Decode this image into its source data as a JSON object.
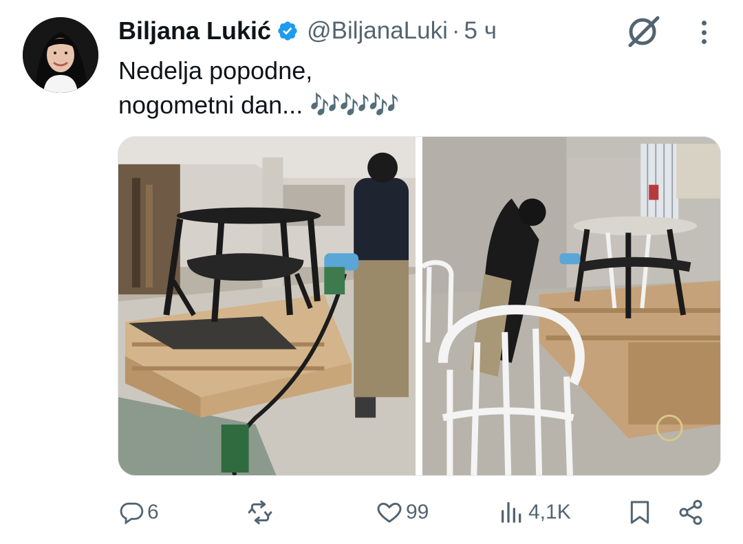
{
  "author": {
    "name": "Biljana Lukić",
    "handle": "@BiljanaLuki",
    "separator": "·",
    "time": "5 ч",
    "verified": true
  },
  "tweet": {
    "line1": "Nedelja popodne,",
    "line2": "nogometni dan...",
    "emoji": "🎶🎶🎶"
  },
  "media": {
    "count": 2
  },
  "actions": {
    "replies": "6",
    "retweets": "",
    "likes": "99",
    "views": "4,1K"
  },
  "colors": {
    "text": "#0f1419",
    "secondary": "#536471",
    "verified": "#1d9bf0"
  },
  "icons": [
    "verified-badge-icon",
    "grok-icon",
    "more-icon",
    "reply-icon",
    "retweet-icon",
    "like-icon",
    "views-icon",
    "bookmark-icon",
    "share-icon"
  ]
}
